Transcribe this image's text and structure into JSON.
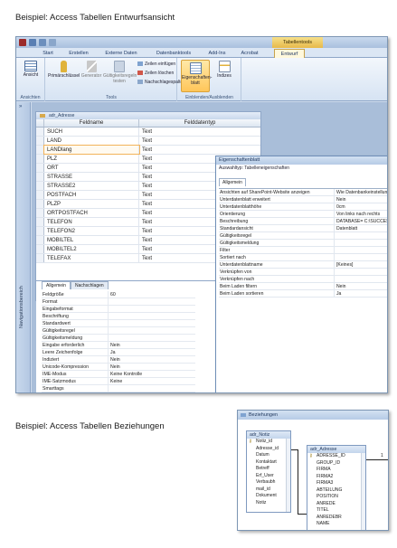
{
  "headings": {
    "entwurf": "Beispiel: Access Tabellen Entwurfsansicht",
    "beziehungen": "Beispiel: Access Tabellen Beziehungen"
  },
  "window": {
    "context_title": "Tabellentools"
  },
  "ribbon": {
    "tabs": [
      "Start",
      "Erstellen",
      "Externe Daten",
      "Datenbanktools",
      "Add-Ins",
      "Acrobat",
      "Entwurf"
    ],
    "active_tab": "Entwurf",
    "groups": {
      "ansichten": "Ansichten",
      "tools": "Tools",
      "einblenden": "Einblenden/Ausblenden"
    },
    "buttons": {
      "ansicht": "Ansicht",
      "primaerschluessel": "Primärschlüssel",
      "generator": "Generator",
      "gueltigkeitsregeln": "Gültigkeitsregeln testen",
      "zeilen_einfuegen": "Zeilen einfügen",
      "zeilen_loeschen": "Zeilen löschen",
      "nachschlagespalte": "Nachschlagespalte",
      "eigenschaftenblatt": "Eigenschaften-blatt",
      "indizes": "Indizes"
    }
  },
  "nav_pane": {
    "label": "Navigationsbereich"
  },
  "designer": {
    "tab": "adr_Adresse",
    "col_feldname": "Feldname",
    "col_felddatentyp": "Felddatentyp",
    "fields": [
      {
        "name": "SUCH",
        "type": "Text"
      },
      {
        "name": "LAND",
        "type": "Text"
      },
      {
        "name": "LANDlang",
        "type": "Text"
      },
      {
        "name": "PLZ",
        "type": "Text"
      },
      {
        "name": "ORT",
        "type": "Text"
      },
      {
        "name": "STRASSE",
        "type": "Text"
      },
      {
        "name": "STRASSE2",
        "type": "Text"
      },
      {
        "name": "POSTFACH",
        "type": "Text"
      },
      {
        "name": "PLZP",
        "type": "Text"
      },
      {
        "name": "ORTPOSTFACH",
        "type": "Text"
      },
      {
        "name": "TELEFON",
        "type": "Text"
      },
      {
        "name": "TELEFON2",
        "type": "Text"
      },
      {
        "name": "MOBILTEL",
        "type": "Text"
      },
      {
        "name": "MOBILTEL2",
        "type": "Text"
      },
      {
        "name": "TELEFAX",
        "type": "Text"
      }
    ],
    "prop_tabs": [
      "Allgemein",
      "Nachschlagen"
    ],
    "field_props": [
      {
        "k": "Feldgröße",
        "v": "60"
      },
      {
        "k": "Format",
        "v": ""
      },
      {
        "k": "Eingabeformat",
        "v": ""
      },
      {
        "k": "Beschriftung",
        "v": ""
      },
      {
        "k": "Standardwert",
        "v": ""
      },
      {
        "k": "Gültigkeitsregel",
        "v": ""
      },
      {
        "k": "Gültigkeitsmeldung",
        "v": ""
      },
      {
        "k": "Eingabe erforderlich",
        "v": "Nein"
      },
      {
        "k": "Leere Zeichenfolge",
        "v": "Ja"
      },
      {
        "k": "Indiziert",
        "v": "Nein"
      },
      {
        "k": "Unicode-Kompression",
        "v": "Nein"
      },
      {
        "k": "IME-Modus",
        "v": "Keine Kontrolle"
      },
      {
        "k": "IME-Satzmodus",
        "v": "Keine"
      },
      {
        "k": "Smarttags",
        "v": ""
      }
    ]
  },
  "property_sheet": {
    "title": "Eigenschaftenblatt",
    "selection_label": "Auswahltyp: Tabelleneigenschaften",
    "tab": "Allgemein",
    "rows": [
      {
        "k": "Ansichten auf SharePoint-Website anzeigen",
        "v": "Wie Datenbankeinstellung"
      },
      {
        "k": "Unterdatenblatt erweitert",
        "v": "Nein"
      },
      {
        "k": "Unterdatenblatthöhe",
        "v": "0cm"
      },
      {
        "k": "Orientierung",
        "v": "Von links nach rechts"
      },
      {
        "k": "Beschreibung",
        "v": "DATABASE= C:\\SUCCESSC("
      },
      {
        "k": "Standardansicht",
        "v": "Datenblatt"
      },
      {
        "k": "Gültigkeitsregel",
        "v": ""
      },
      {
        "k": "Gültigkeitsmeldung",
        "v": ""
      },
      {
        "k": "Filter",
        "v": ""
      },
      {
        "k": "Sortiert nach",
        "v": ""
      },
      {
        "k": "Unterdatenblattname",
        "v": "[Keines]"
      },
      {
        "k": "Verknüpfen von",
        "v": ""
      },
      {
        "k": "Verknüpfen nach",
        "v": ""
      },
      {
        "k": "Beim Laden filtern",
        "v": "Nein"
      },
      {
        "k": "Beim Laden sortieren",
        "v": "Ja"
      }
    ]
  },
  "relationships": {
    "title": "Beziehungen",
    "tables": [
      {
        "name": "adr_Notiz",
        "fields": [
          "Notiz_id",
          "Adresse_id",
          "Datum",
          "Kontaktart",
          "Betreff",
          "Erf_User",
          "Verbaubh",
          "mail_id",
          "Dokument",
          "Notiz"
        ]
      },
      {
        "name": "adr_Adresse",
        "fields": [
          "ADRESSE_ID",
          "GROUP_ID",
          "FIRMA",
          "FIRMA2",
          "FIRMA3",
          "ABTEILUNG",
          "POSITION",
          "ANREDE",
          "TITEL",
          "ANREDEBR",
          "NAME"
        ]
      }
    ],
    "cardinality": "1"
  }
}
